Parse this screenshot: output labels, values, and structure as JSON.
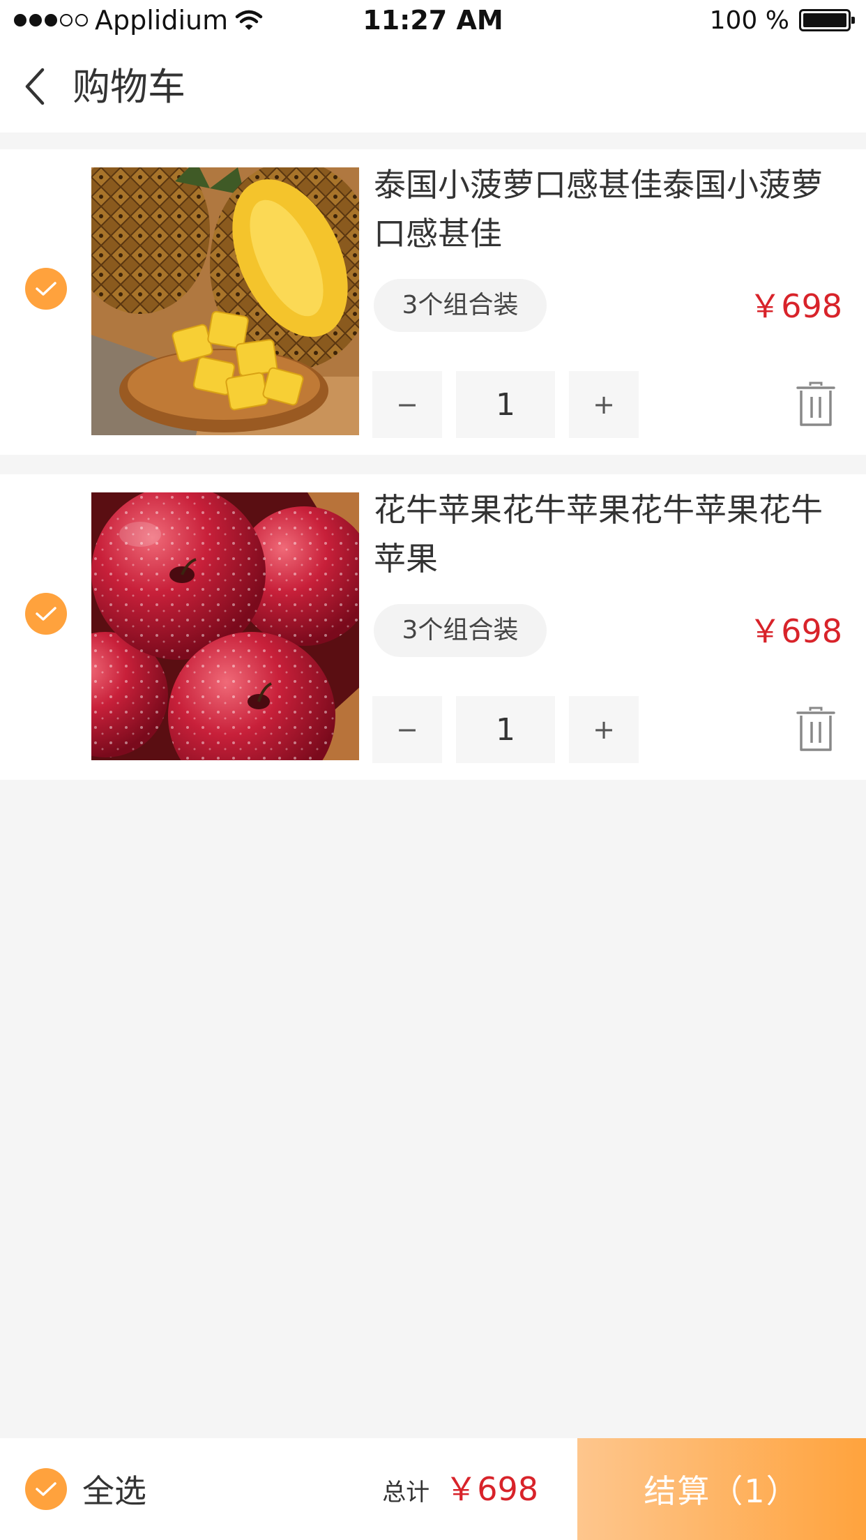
{
  "status_bar": {
    "carrier": "Applidium",
    "time": "11:27 AM",
    "battery_text": "100 %"
  },
  "nav": {
    "title": "购物车",
    "back_icon": "chevron-left-icon"
  },
  "cart": {
    "items": [
      {
        "name": "泰国小菠萝口感甚佳泰国小菠萝口感甚佳",
        "spec": "3个组合装",
        "price": "￥698",
        "quantity": "1",
        "minus_label": "−",
        "plus_label": "+",
        "checked": true,
        "image": "pineapple-image"
      },
      {
        "name": "花牛苹果花牛苹果花牛苹果花牛苹果",
        "spec": "3个组合装",
        "price": "￥698",
        "quantity": "1",
        "minus_label": "−",
        "plus_label": "+",
        "checked": true,
        "image": "apple-image"
      }
    ]
  },
  "footer": {
    "select_all_label": "全选",
    "total_label": "总计",
    "total_amount": "￥698",
    "checkout_label": "结算（1）"
  },
  "colors": {
    "accent_orange": "#ffa23d",
    "price_red": "#d8232a",
    "background": "#f5f5f5"
  }
}
